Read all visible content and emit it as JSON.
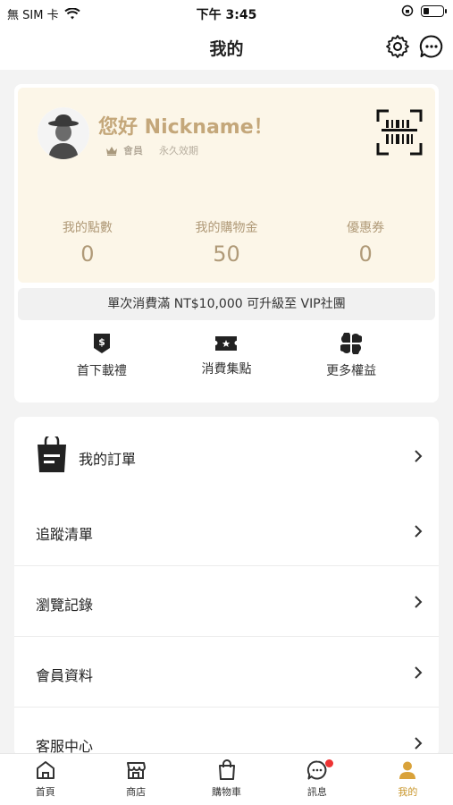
{
  "status_bar": {
    "carrier": "無 SIM 卡",
    "time": "下午 3:45",
    "battery_level": 0.3
  },
  "nav": {
    "title": "我的"
  },
  "member": {
    "greeting": "您好 Nickname！",
    "tier": "會員",
    "validity": "永久效期",
    "stats": [
      {
        "label": "我的點數",
        "value": "0"
      },
      {
        "label": "我的購物金",
        "value": "50"
      },
      {
        "label": "優惠券",
        "value": "0"
      }
    ],
    "upgrade_text": "單次消費滿 NT$10,000 可升級至 VIP社團",
    "benefits": [
      {
        "label": "首下載禮",
        "icon": "gift-tag-icon"
      },
      {
        "label": "消費集點",
        "icon": "ticket-icon"
      },
      {
        "label": "更多權益",
        "icon": "grid-icon"
      }
    ]
  },
  "menu": {
    "items": [
      {
        "label": "我的訂單"
      },
      {
        "label": "追蹤清單"
      },
      {
        "label": "瀏覽記錄"
      },
      {
        "label": "會員資料"
      },
      {
        "label": "客服中心"
      }
    ]
  },
  "tabs": [
    {
      "label": "首頁",
      "icon": "home-icon"
    },
    {
      "label": "商店",
      "icon": "store-icon"
    },
    {
      "label": "購物車",
      "icon": "shopping-bag-icon"
    },
    {
      "label": "訊息",
      "icon": "chat-icon"
    },
    {
      "label": "我的",
      "icon": "user-icon",
      "active": true
    }
  ],
  "colors": {
    "accent_gold": "#c9962a",
    "card_cream": "#fcf6e8",
    "badge_red": "#e33333"
  }
}
